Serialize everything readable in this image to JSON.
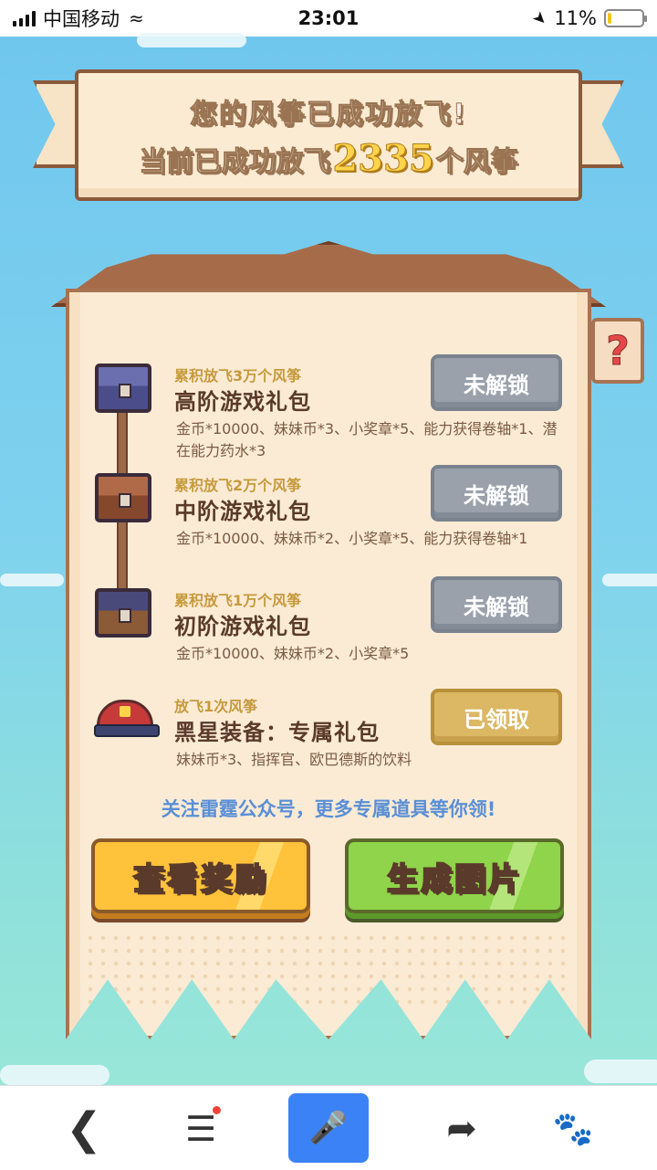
{
  "status_bar": {
    "carrier": "中国移动",
    "time": "23:01",
    "battery_percent": "11%",
    "battery_level": 0.11
  },
  "banner": {
    "line1": "您的风筝已成功放飞!",
    "line2_prefix": "当前已成功放飞",
    "count": "2335",
    "line2_suffix": "个风筝"
  },
  "help": {
    "label": "?"
  },
  "rewards": [
    {
      "requirement": "累积放飞3万个风筝",
      "title": "高阶游戏礼包",
      "description": "金币*10000、妹妹币*3、小奖章*5、能力获得卷轴*1、潜在能力药水*3",
      "status": "未解锁",
      "icon": "chest-high-icon"
    },
    {
      "requirement": "累积放飞2万个风筝",
      "title": "中阶游戏礼包",
      "description": "金币*10000、妹妹币*2、小奖章*5、能力获得卷轴*1",
      "status": "未解锁",
      "icon": "chest-mid-icon"
    },
    {
      "requirement": "累积放飞1万个风筝",
      "title": "初阶游戏礼包",
      "description": "金币*10000、妹妹币*2、小奖章*5",
      "status": "未解锁",
      "icon": "chest-low-icon"
    },
    {
      "requirement": "放飞1次风筝",
      "title": "黑星装备：专属礼包",
      "description": "妹妹币*3、指挥官、欧巴德斯的饮料",
      "status": "已领取",
      "icon": "red-hat-icon"
    }
  ],
  "follow_text": "关注雷霆公众号，更多专属道具等你领!",
  "buttons": {
    "view_rewards": "查看奖励",
    "generate_image": "生成图片"
  },
  "colors": {
    "sky_top": "#6fc6ee",
    "panel_bg": "#fbebd5",
    "locked_button": "#9aa1ab",
    "claimed_button": "#dcb864",
    "yellow_button": "#ffc23a",
    "green_button": "#8fd44a",
    "mic_button": "#3b82f6"
  }
}
